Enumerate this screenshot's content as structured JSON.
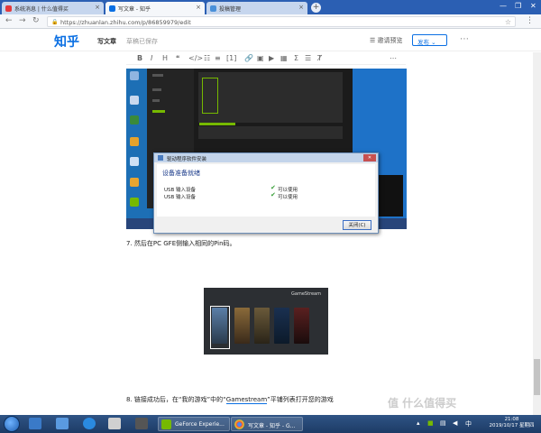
{
  "browser": {
    "tabs": [
      {
        "label": "系统消息 | 什么值得买"
      },
      {
        "label": "写文章 - 知乎"
      },
      {
        "label": "投稿管理"
      }
    ],
    "url": "https://zhuanlan.zhihu.com/p/86859979/edit"
  },
  "zhihu": {
    "logo": "知乎",
    "write": "写文章",
    "draft_status": "草稿已保存",
    "invite": "邀请预览",
    "publish": "发布"
  },
  "dialog": {
    "title": "驱动程序软件安装",
    "heading": "设备准备就绪",
    "rows": [
      {
        "device": "USB 输入设备",
        "status": "可以使用"
      },
      {
        "device": "USB 输入设备",
        "status": "可以使用"
      }
    ],
    "close_button": "关闭(C)"
  },
  "article": {
    "step7": "7. 然后在PC GFE侧输入相同的Pin码。",
    "step7_underline": "GFE",
    "step8_a": "8. 链接成功后，在“我的游戏”中的“",
    "step8_b": "Gamestream",
    "step8_c": "”平铺列表打开您的游戏"
  },
  "gamestream": {
    "title": "GameStream"
  },
  "taskbar": {
    "apps": [
      {
        "label": "GeForce Experie..."
      },
      {
        "label": "写文章 - 知乎 - G..."
      }
    ],
    "time": "21:08",
    "date": "2019/10/17 星期四"
  },
  "watermark": "值 什么值得买",
  "colors": {
    "zhihu_blue": "#0a6fe3",
    "nvidia_green": "#76b900",
    "check_green": "#3aa03a"
  }
}
